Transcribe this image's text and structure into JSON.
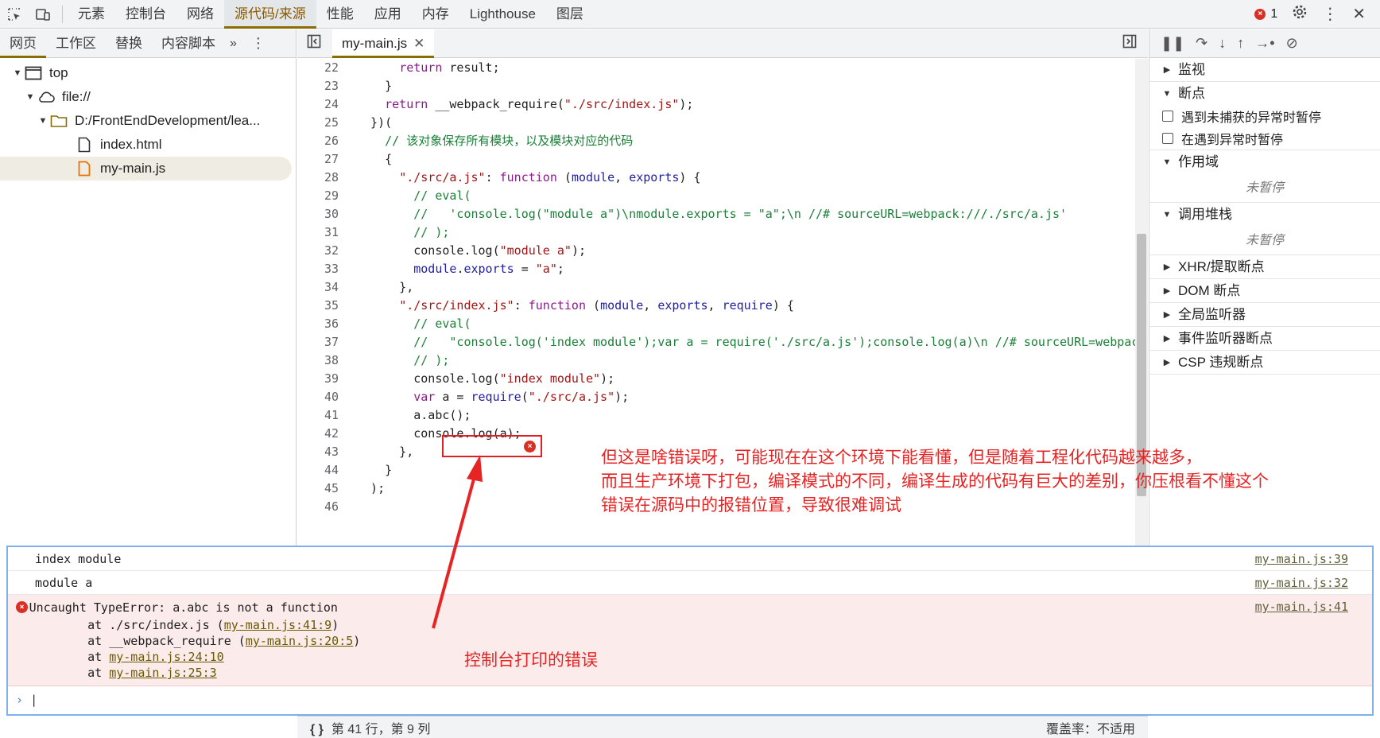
{
  "topbar": {
    "tabs": [
      "元素",
      "控制台",
      "网络",
      "源代码/来源",
      "性能",
      "应用",
      "内存",
      "Lighthouse",
      "图层"
    ],
    "active_tab": "源代码/来源",
    "error_count": "1"
  },
  "navigator": {
    "tabs": [
      "网页",
      "工作区",
      "替换",
      "内容脚本"
    ],
    "tree": [
      {
        "label": "top",
        "icon": "window-icon"
      },
      {
        "label": "file://",
        "icon": "cloud-icon"
      },
      {
        "label": "D:/FrontEndDevelopment/lea...",
        "icon": "folder-icon"
      },
      {
        "label": "index.html",
        "icon": "file-icon"
      },
      {
        "label": "my-main.js",
        "icon": "js-file-icon"
      }
    ]
  },
  "editor": {
    "tab_label": "my-main.js",
    "lines": [
      {
        "n": "22",
        "t": "      return result;"
      },
      {
        "n": "23",
        "t": "    }"
      },
      {
        "n": "24",
        "t": "    return __webpack_require(\"./src/index.js\");"
      },
      {
        "n": "25",
        "t": "  })("
      },
      {
        "n": "26",
        "t": "    // 该对象保存所有模块，以及模块对应的代码"
      },
      {
        "n": "27",
        "t": "    {"
      },
      {
        "n": "28",
        "t": "      \"./src/a.js\": function (module, exports) {"
      },
      {
        "n": "29",
        "t": "        // eval("
      },
      {
        "n": "30",
        "t": "        //   'console.log(\"module a\")\\nmodule.exports = \"a\";\\n //# sourceURL=webpack:///./src/a.js'"
      },
      {
        "n": "31",
        "t": "        // );"
      },
      {
        "n": "32",
        "t": "        console.log(\"module a\");"
      },
      {
        "n": "33",
        "t": "        module.exports = \"a\";"
      },
      {
        "n": "34",
        "t": "      },"
      },
      {
        "n": "35",
        "t": "      \"./src/index.js\": function (module, exports, require) {"
      },
      {
        "n": "36",
        "t": "        // eval("
      },
      {
        "n": "37",
        "t": "        //   \"console.log('index module');var a = require('./src/a.js');console.log(a)\\n //# sourceURL=webpack"
      },
      {
        "n": "38",
        "t": "        // );"
      },
      {
        "n": "39",
        "t": "        console.log(\"index module\");"
      },
      {
        "n": "40",
        "t": "        var a = require(\"./src/a.js\");"
      },
      {
        "n": "41",
        "t": "        a.abc();"
      },
      {
        "n": "42",
        "t": "        console.log(a);"
      },
      {
        "n": "43",
        "t": "      },"
      },
      {
        "n": "44",
        "t": "    }"
      },
      {
        "n": "45",
        "t": "  );"
      },
      {
        "n": "46",
        "t": ""
      }
    ]
  },
  "debugger": {
    "sections": {
      "watch": "监视",
      "breakpoints": "断点",
      "cb_uncaught": "遇到未捕获的异常时暂停",
      "cb_caught": "在遇到异常时暂停",
      "scope": "作用域",
      "not_paused_1": "未暂停",
      "callstack": "调用堆栈",
      "not_paused_2": "未暂停",
      "xhr": "XHR/提取断点",
      "dom": "DOM 断点",
      "global": "全局监听器",
      "event": "事件监听器断点",
      "csp": "CSP 违规断点"
    }
  },
  "console": {
    "rows": [
      {
        "msg": "index module",
        "src": "my-main.js:39"
      },
      {
        "msg": "module a",
        "src": "my-main.js:32"
      }
    ],
    "error": {
      "title": "Uncaught TypeError: a.abc is not a function",
      "src": "my-main.js:41",
      "stack": [
        {
          "pre": "    at ./src/index.js (",
          "link": "my-main.js:41:9",
          "post": ")"
        },
        {
          "pre": "    at __webpack_require (",
          "link": "my-main.js:20:5",
          "post": ")"
        },
        {
          "pre": "    at ",
          "link": "my-main.js:24:10",
          "post": ""
        },
        {
          "pre": "    at ",
          "link": "my-main.js:25:3",
          "post": ""
        }
      ]
    },
    "prompt": "›"
  },
  "statusbar": {
    "position": "第 41 行，第 9 列",
    "coverage": "覆盖率：不适用"
  },
  "annotations": {
    "note_main": [
      "但这是啥错误呀，可能现在在这个环境下能看懂，但是随着工程化代码越来越多，",
      "而且生产环境下打包，编译模式的不同，编译生成的代码有巨大的差别，你压根看不懂这个",
      "错误在源码中的报错位置，导致很难调试"
    ],
    "note_console": "控制台打印的错误",
    "color": "#e62424"
  }
}
